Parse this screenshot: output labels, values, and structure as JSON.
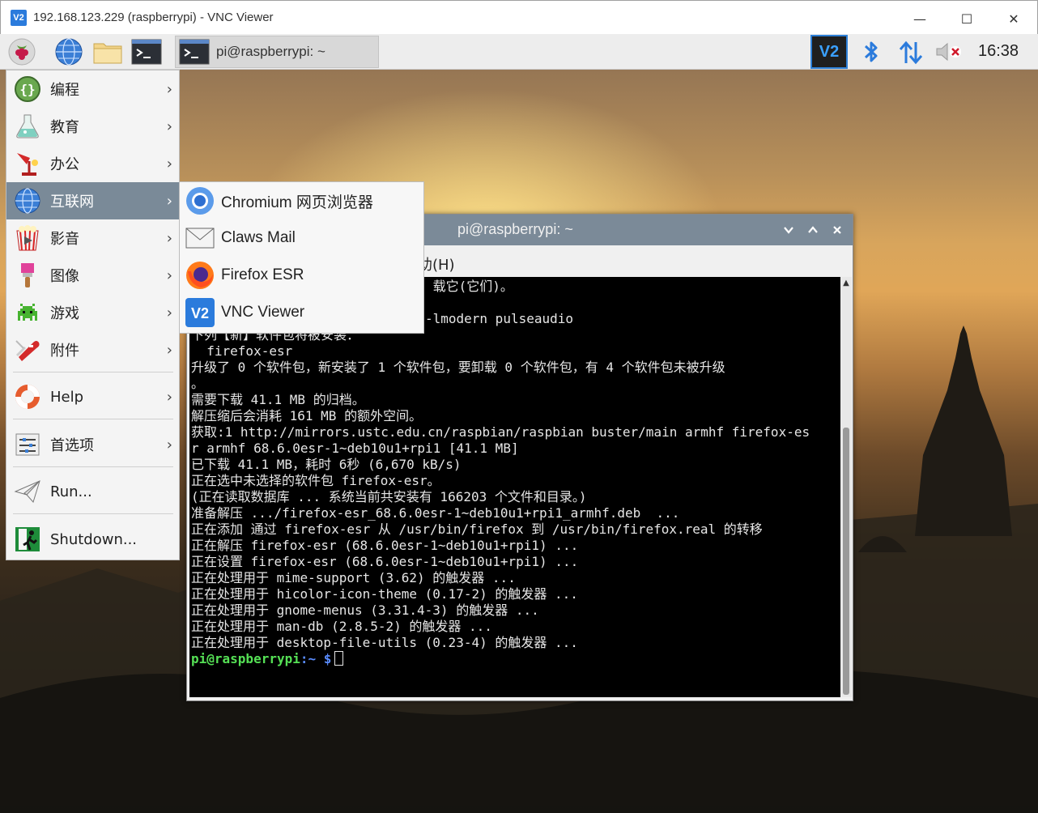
{
  "vnc_window": {
    "logo": "V2",
    "title": "192.168.123.229 (raspberrypi) - VNC Viewer",
    "minimize": "—",
    "maximize": "☐",
    "close": "✕"
  },
  "panel": {
    "icons": [
      "raspberry-icon",
      "globe-icon",
      "folder-icon",
      "terminal-icon"
    ],
    "task_label": "pi@raspberrypi: ~",
    "vnc_server_label": "V2",
    "clock": "16:38"
  },
  "menu": {
    "items": [
      {
        "label": "编程",
        "icon": "programming-icon",
        "has_submenu": true
      },
      {
        "label": "教育",
        "icon": "education-icon",
        "has_submenu": true
      },
      {
        "label": "办公",
        "icon": "office-icon",
        "has_submenu": true
      },
      {
        "label": "互联网",
        "icon": "globe-icon",
        "has_submenu": true
      },
      {
        "label": "影音",
        "icon": "media-icon",
        "has_submenu": true
      },
      {
        "label": "图像",
        "icon": "graphics-icon",
        "has_submenu": true
      },
      {
        "label": "游戏",
        "icon": "games-icon",
        "has_submenu": true
      },
      {
        "label": "附件",
        "icon": "accessories-icon",
        "has_submenu": true
      },
      {
        "label": "Help",
        "icon": "help-icon",
        "has_submenu": true
      },
      {
        "label": "首选项",
        "icon": "preferences-icon",
        "has_submenu": true
      },
      {
        "label": "Run...",
        "icon": "run-icon",
        "has_submenu": false
      },
      {
        "label": "Shutdown...",
        "icon": "shutdown-icon",
        "has_submenu": false
      }
    ],
    "arrow": "›",
    "active_item": "互联网"
  },
  "submenu": {
    "items": [
      {
        "label": "Chromium 网页浏览器",
        "icon": "chromium-icon"
      },
      {
        "label": "Claws Mail",
        "icon": "mail-icon"
      },
      {
        "label": "Firefox ESR",
        "icon": "firefox-icon"
      },
      {
        "label": "VNC Viewer",
        "icon": "vnc-icon"
      }
    ]
  },
  "terminal": {
    "title": "pi@raspberrypi: ~",
    "menu_partial": "助(H)",
    "lines": [
      "                               载它(它们)。",
      "",
      "                              -lmodern pulseaudio",
      "下列【新】软件包将被安装：",
      "  firefox-esr",
      "升级了 0 个软件包，新安装了 1 个软件包，要卸载 0 个软件包，有 4 个软件包未被升级",
      "。",
      "需要下载 41.1 MB 的归档。",
      "解压缩后会消耗 161 MB 的额外空间。",
      "获取:1 http://mirrors.ustc.edu.cn/raspbian/raspbian buster/main armhf firefox-es",
      "r armhf 68.6.0esr-1~deb10u1+rpi1 [41.1 MB]",
      "已下载 41.1 MB，耗时 6秒 (6,670 kB/s)",
      "正在选中未选择的软件包 firefox-esr。",
      "(正在读取数据库 ... 系统当前共安装有 166203 个文件和目录。)",
      "准备解压 .../firefox-esr_68.6.0esr-1~deb10u1+rpi1_armhf.deb  ...",
      "正在添加 通过 firefox-esr 从 /usr/bin/firefox 到 /usr/bin/firefox.real 的转移",
      "正在解压 firefox-esr (68.6.0esr-1~deb10u1+rpi1) ...",
      "正在设置 firefox-esr (68.6.0esr-1~deb10u1+rpi1) ...",
      "正在处理用于 mime-support (3.62) 的触发器 ...",
      "正在处理用于 hicolor-icon-theme (0.17-2) 的触发器 ...",
      "正在处理用于 gnome-menus (3.31.4-3) 的触发器 ...",
      "正在处理用于 man-db (2.8.5-2) 的触发器 ...",
      "正在处理用于 desktop-file-utils (0.23-4) 的触发器 ..."
    ],
    "prompt_user": "pi@raspberrypi",
    "prompt_path": ":~ $"
  },
  "colors": {
    "panel_bg": "#ededed",
    "menu_active": "#7a8a98",
    "terminal_bg": "#000000",
    "prompt_user": "#55e055",
    "prompt_path": "#5a8cff"
  }
}
